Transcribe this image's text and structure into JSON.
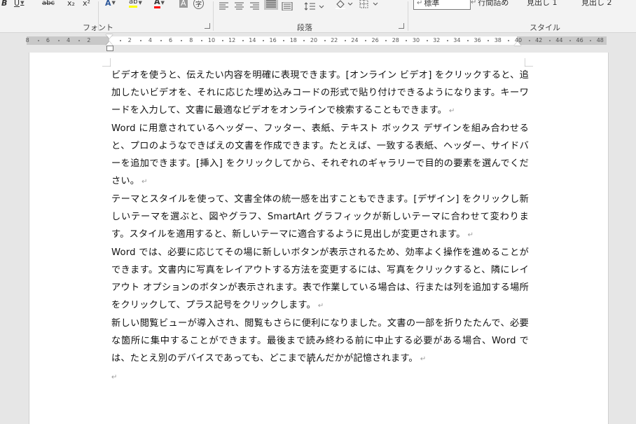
{
  "ribbon": {
    "groups": {
      "font": "フォント",
      "paragraph": "段落",
      "styles": "スタイル"
    },
    "font_buttons": {
      "bold": "B",
      "underline": "U",
      "strikethrough": "abc",
      "subscript": "x₂",
      "superscript": "x²",
      "text_effects": "A",
      "highlight": "ab",
      "font_color": "A",
      "char_shading": "A",
      "enclose": "字"
    },
    "styles_gallery": [
      {
        "label": "標準",
        "selected": true
      },
      {
        "label": "行間詰め",
        "selected": false
      },
      {
        "label": "見出し 1",
        "selected": false
      },
      {
        "label": "見出し 2",
        "selected": false
      }
    ],
    "style_marker": "↵",
    "highlight_color": "#ffff00",
    "font_color_value": "#ff0000",
    "accent": "#2b579a"
  },
  "ruler": {
    "left_numbers": [
      "8",
      "6",
      "4",
      "2"
    ],
    "right_numbers": [
      "2",
      "4",
      "6",
      "8",
      "10",
      "12",
      "14",
      "16",
      "18",
      "20",
      "22",
      "24",
      "26",
      "28",
      "30",
      "32",
      "34",
      "36",
      "38",
      "40",
      "42",
      "44",
      "46",
      "48"
    ]
  },
  "document": {
    "paragraphs": [
      "ビデオを使うと、伝えたい内容を明確に表現できます。[オンライン ビデオ] をクリックすると、追加したいビデオを、それに応じた埋め込みコードの形式で貼り付けできるようになります。キーワードを入力して、文書に最適なビデオをオンラインで検索することもできます。",
      "Word に用意されているヘッダー、フッター、表紙、テキスト ボックス デザインを組み合わせると、プロのようなできばえの文書を作成できます。たとえば、一致する表紙、ヘッダー、サイドバーを追加できます。[挿入] をクリックしてから、それぞれのギャラリーで目的の要素を選んでください。",
      "テーマとスタイルを使って、文書全体の統一感を出すこともできます。[デザイン] をクリックし新しいテーマを選ぶと、図やグラフ、SmartArt グラフィックが新しいテーマに合わせて変わります。スタイルを適用すると、新しいテーマに適合するように見出しが変更されます。",
      "Word では、必要に応じてその場に新しいボタンが表示されるため、効率よく操作を進めることができます。文書内に写真をレイアウトする方法を変更するには、写真をクリックすると、隣にレイアウト オプションのボタンが表示されます。表で作業している場合は、行または列を追加する場所をクリックして、プラス記号をクリックします。",
      "新しい閲覧ビューが導入され、閲覧もさらに便利になりました。文書の一部を折りたたんで、必要な箇所に集中することができます。最後まで読み終わる前に中止する必要がある場合、Word では、たとえ別のデバイスであっても、どこまで読んだかが記憶されます。",
      ""
    ],
    "paragraph_mark": "↵",
    "ibeam": "I"
  }
}
